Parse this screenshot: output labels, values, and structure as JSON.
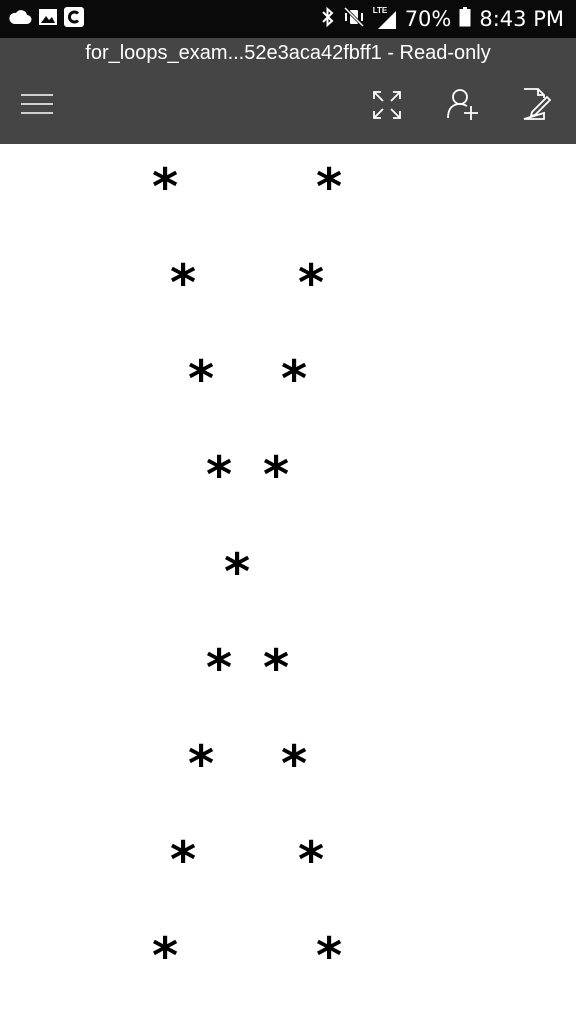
{
  "status_bar": {
    "left_icons": [
      "cloud-icon",
      "image-icon",
      "c-app-icon"
    ],
    "right_icons": [
      "bluetooth-icon",
      "vibrate-mute-icon",
      "lte-signal-icon",
      "battery-icon"
    ],
    "lte_label": "LTE",
    "battery": "70%",
    "time": "8:43 PM"
  },
  "header": {
    "title": "for_loops_exam...52e3aca42fbff1 - Read-only",
    "icons": [
      "menu-icon",
      "fullscreen-icon",
      "add-person-icon",
      "edit-document-icon"
    ]
  },
  "document": {
    "stars": [
      "*",
      "*",
      "*",
      "*",
      "*",
      "*",
      "*",
      "*",
      "*",
      "*",
      "*",
      "*",
      "*",
      "*",
      "*",
      "*",
      "*"
    ]
  },
  "colors": {
    "status_bar_bg": "#0a0a0a",
    "header_bg": "#454545",
    "page_bg": "#ffffff",
    "text": "#000000"
  }
}
